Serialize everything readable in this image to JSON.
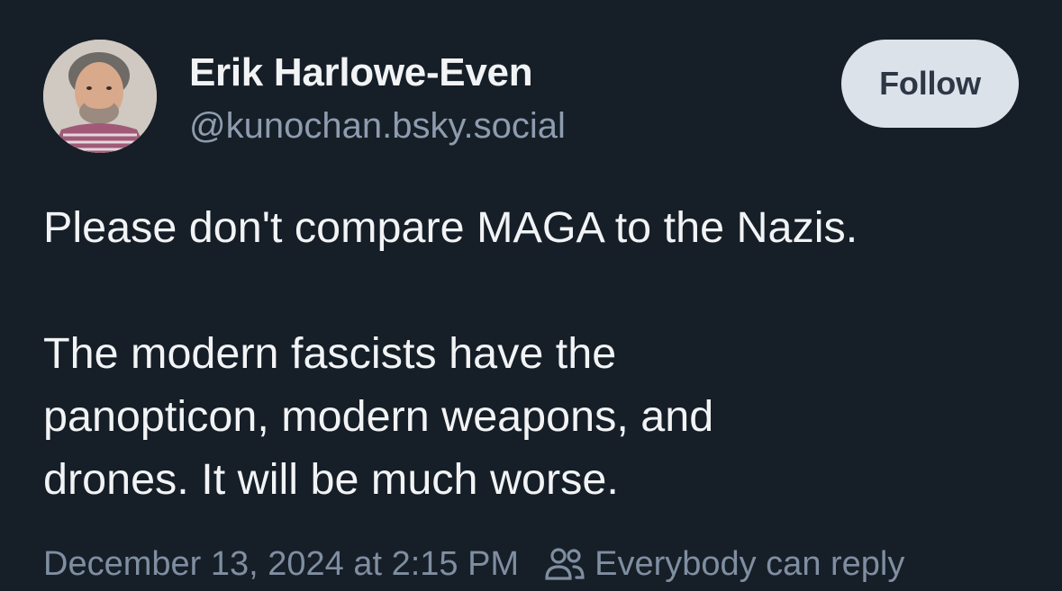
{
  "author": {
    "display_name": "Erik Harlowe-Even",
    "handle": "@kunochan.bsky.social",
    "avatar_icon": "profile-photo"
  },
  "follow_button": {
    "label": "Follow"
  },
  "post": {
    "paragraph1": "Please don't compare MAGA to the Nazis.",
    "paragraph2_lines": [
      "The modern fascists have the",
      "panopticon, modern weapons, and",
      "drones. It will be much worse."
    ]
  },
  "meta": {
    "timestamp": "December 13, 2024 at 2:15 PM",
    "reply_icon": "people-icon",
    "reply_setting": "Everybody can reply"
  },
  "colors": {
    "background": "#161e27",
    "text_primary": "#f1f3f5",
    "text_secondary": "#8d9cae",
    "button_bg": "#dce2ea",
    "button_text": "#2d3745"
  }
}
